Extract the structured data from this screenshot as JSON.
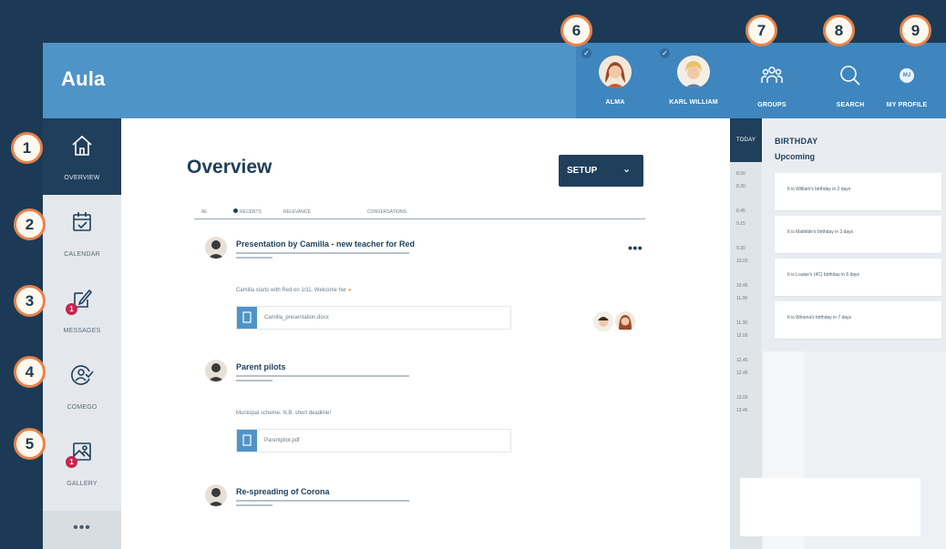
{
  "brand": "Aula",
  "profiles": [
    {
      "name": "ALMA"
    },
    {
      "name": "KARL WILLIAM"
    }
  ],
  "nav": [
    {
      "label": "GROUPS",
      "icon": "groups-icon"
    },
    {
      "label": "SEARCH",
      "icon": "search-icon"
    },
    {
      "label": "MY PROFILE",
      "icon": "profile-icon",
      "initials": "MJ"
    }
  ],
  "sidebar": {
    "items": [
      {
        "label": "OVERVIEW",
        "icon": "home-icon"
      },
      {
        "label": "CALENDAR",
        "icon": "calendar-icon"
      },
      {
        "label": "MESSAGES",
        "icon": "messages-icon",
        "badge": "1"
      },
      {
        "label": "COMEGO",
        "icon": "comego-icon"
      },
      {
        "label": "GALLERY",
        "icon": "gallery-icon",
        "badge": "1"
      }
    ],
    "more": "•••"
  },
  "main": {
    "title": "Overview",
    "setup": "SETUP",
    "setup_chevron": "⌄",
    "filters": [
      "All",
      "RECENTS",
      "RELEVANCE",
      "CONVERSATIONS"
    ],
    "more_dots": "•••",
    "posts": [
      {
        "title": "Presentation by Camilla - new teacher for Red",
        "body": "Camilla starts with Red on 1/11. Welcome her",
        "attachment": "Camilla_presentation.docx"
      },
      {
        "title": "Parent pilots",
        "body": "Municipal scheme. N.B. short deadline!",
        "attachment": "Parentpilot.pdf"
      },
      {
        "title": "Re-spreading of Corona"
      }
    ]
  },
  "schedule": {
    "today": "TODAY",
    "times": [
      "8.00",
      "8.30",
      "8.45",
      "9.15",
      "9.30",
      "10.00",
      "10.45",
      "11.00",
      "11.30",
      "12.00",
      "12.45",
      "12.45",
      "13.00",
      "13.45"
    ]
  },
  "birthday": {
    "heading": "BIRTHDAY",
    "subheading": "Upcoming",
    "items": [
      "It is William's birthday in 2 days",
      "It is Mathilde's birthday in 3 days",
      "It is Louise's (4C) birthday in 6 days",
      "It is Winona's birthday in 7 days"
    ]
  },
  "callouts": [
    "1",
    "2",
    "3",
    "4",
    "5",
    "6",
    "7",
    "8",
    "9"
  ],
  "colors": {
    "page_bg": "#1c3a55",
    "header_blue": "#4f94c8",
    "navy": "#1f3f5b",
    "callout_border": "#e7834a",
    "badge_red": "#c4264d"
  }
}
